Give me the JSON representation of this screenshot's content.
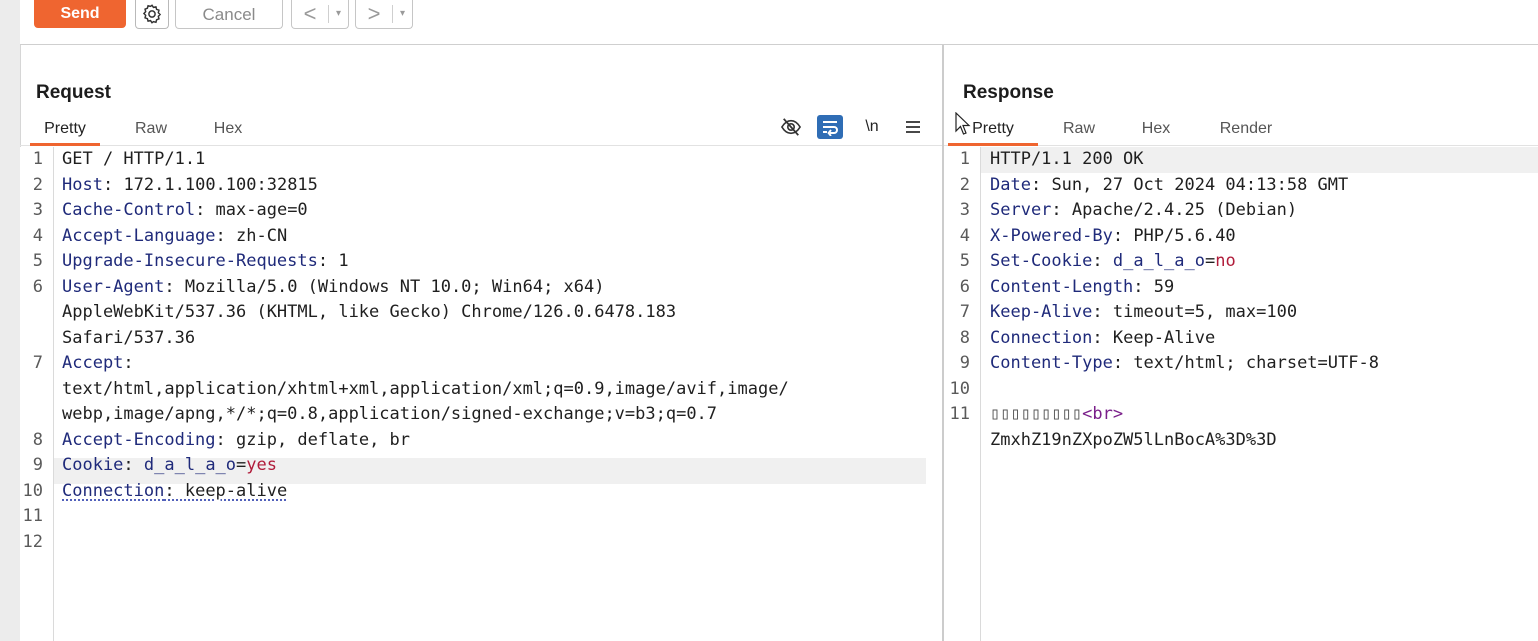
{
  "toolbar": {
    "send_label": "Send",
    "cancel_label": "Cancel",
    "back_label": "<",
    "forward_label": ">",
    "dropdown_glyph": "▾"
  },
  "request": {
    "title": "Request",
    "tabs": [
      "Pretty",
      "Raw",
      "Hex"
    ],
    "active_tab": "Pretty",
    "tools": [
      "eye-off-icon",
      "word-wrap-icon",
      "newline-toggle",
      "menu-icon"
    ],
    "newline_label": "\\n",
    "line_numbers": [
      "1",
      "2",
      "3",
      "4",
      "5",
      "6",
      "7",
      "8",
      "9",
      "10",
      "11",
      "12"
    ],
    "lines": [
      {
        "key": "",
        "val": "GET / HTTP/1.1"
      },
      {
        "key": "Host",
        "val": "172.1.100.100:32815"
      },
      {
        "key": "Cache-Control",
        "val": "max-age=0"
      },
      {
        "key": "Accept-Language",
        "val": "zh-CN"
      },
      {
        "key": "Upgrade-Insecure-Requests",
        "val": "1"
      },
      {
        "key": "User-Agent",
        "val": "Mozilla/5.0 (Windows NT 10.0; Win64; x64)"
      },
      {
        "key": "",
        "val": "AppleWebKit/537.36 (KHTML, like Gecko) Chrome/126.0.6478.183"
      },
      {
        "key": "",
        "val": "Safari/537.36"
      },
      {
        "key": "Accept",
        "val": ""
      },
      {
        "key": "",
        "val": "text/html,application/xhtml+xml,application/xml;q=0.9,image/avif,image/"
      },
      {
        "key": "",
        "val": "webp,image/apng,*/*;q=0.8,application/signed-exchange;v=b3;q=0.7"
      },
      {
        "key": "Accept-Encoding",
        "val": "gzip, deflate, br"
      },
      {
        "key": "Cookie",
        "cookie_name": "d_a_l_a_o",
        "cookie_value": "yes"
      },
      {
        "key": "Connection",
        "val": "keep-alive"
      }
    ]
  },
  "response": {
    "title": "Response",
    "tabs": [
      "Pretty",
      "Raw",
      "Hex",
      "Render"
    ],
    "active_tab": "Pretty",
    "line_numbers": [
      "1",
      "2",
      "3",
      "4",
      "5",
      "6",
      "7",
      "8",
      "9",
      "10",
      "11"
    ],
    "lines": [
      {
        "key": "",
        "val": "HTTP/1.1 200 OK"
      },
      {
        "key": "Date",
        "val": "Sun, 27 Oct 2024 04:13:58 GMT"
      },
      {
        "key": "Server",
        "val": "Apache/2.4.25 (Debian)"
      },
      {
        "key": "X-Powered-By",
        "val": "PHP/5.6.40"
      },
      {
        "key": "Set-Cookie",
        "cookie_name": "d_a_l_a_o",
        "cookie_value": "no"
      },
      {
        "key": "Content-Length",
        "val": "59"
      },
      {
        "key": "Keep-Alive",
        "val": "timeout=5, max=100"
      },
      {
        "key": "Connection",
        "val": "Keep-Alive"
      },
      {
        "key": "Content-Type",
        "val": "text/html; charset=UTF-8"
      },
      {
        "key": "",
        "val": ""
      },
      {
        "key": "",
        "garbled": "▯▯▯▯▯▯▯▯▯",
        "tag": "<br>"
      },
      {
        "key": "",
        "val": "ZmxhZ19nZXpoZW5lLnBocA%3D%3D"
      }
    ]
  },
  "colors": {
    "accent": "#ef6530",
    "header_key": "#1f2a7a",
    "cookie_value": "#b01c3a",
    "html_tag": "#7a1f8a",
    "wrap_button": "#2f6db5"
  }
}
